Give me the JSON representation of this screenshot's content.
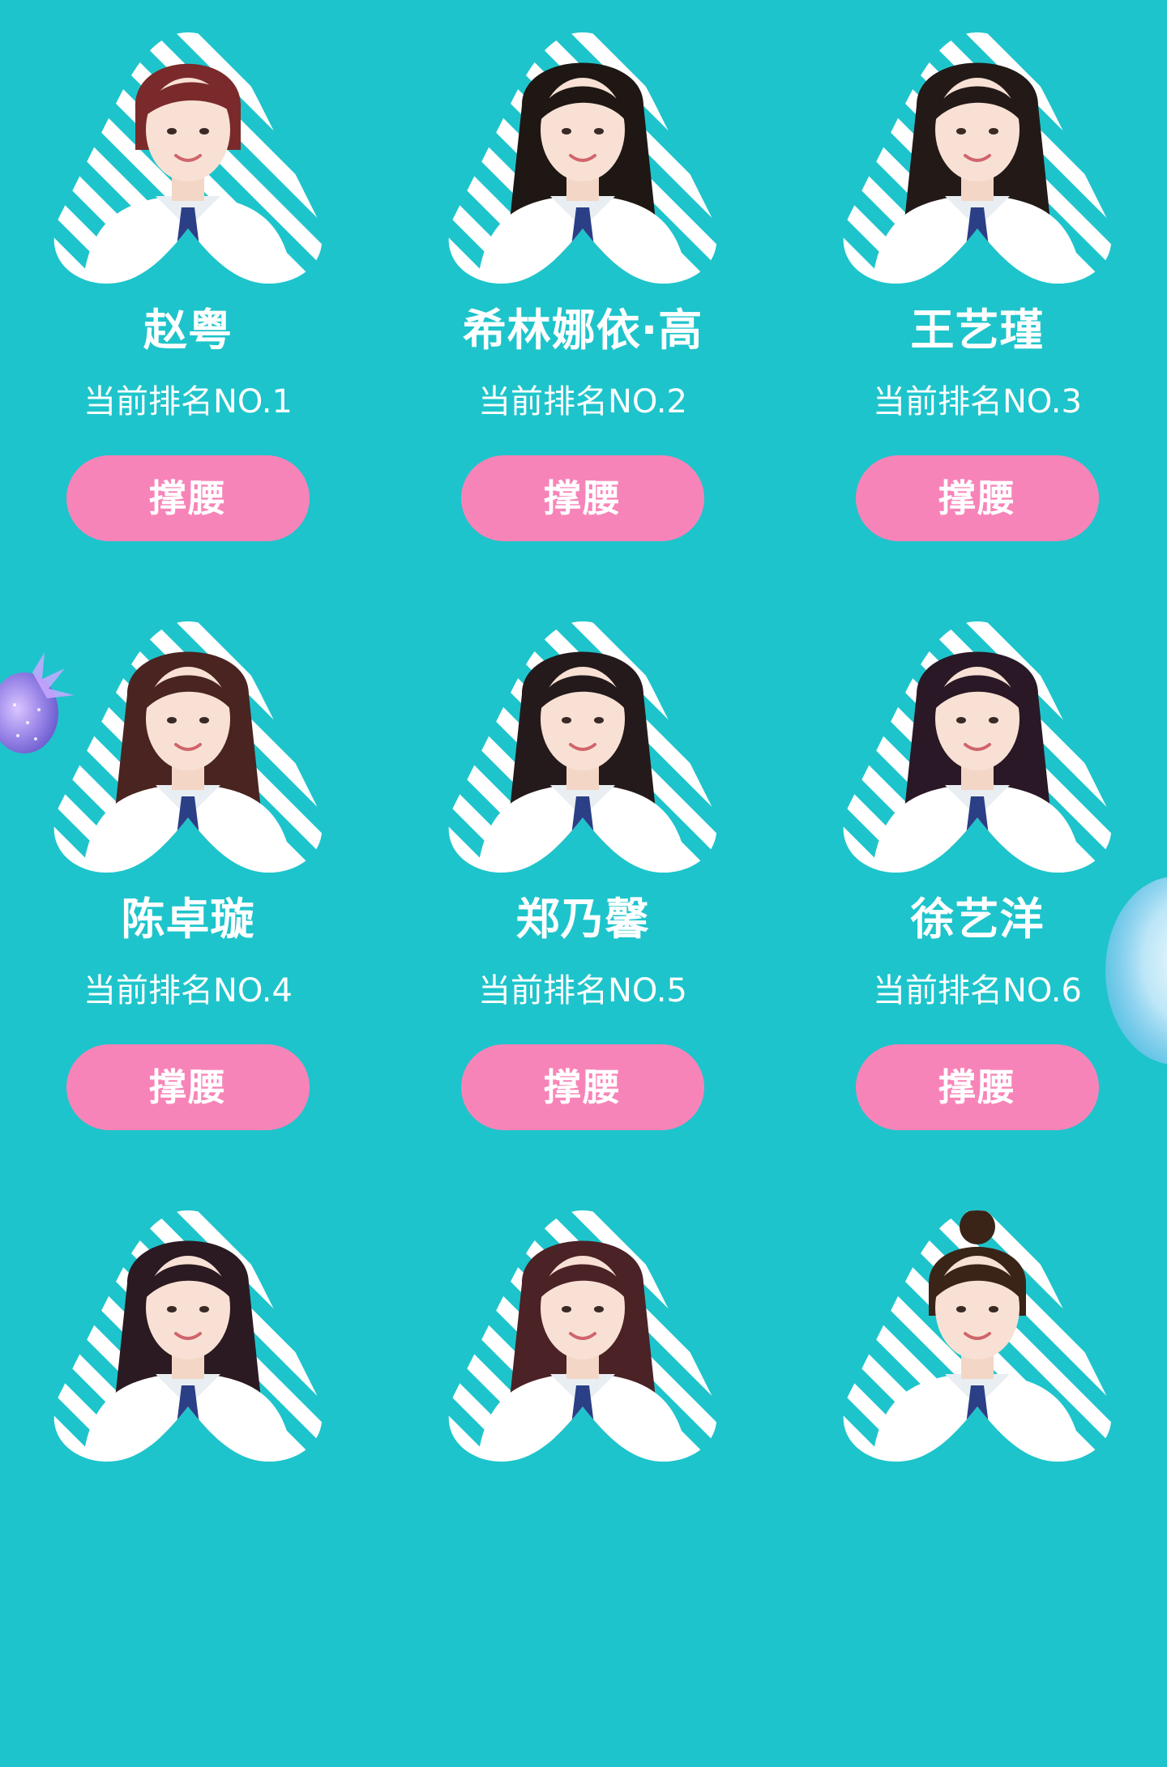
{
  "theme": {
    "background": "#1ec4cb",
    "button_color": "#f784b8",
    "stripe_color": "#1ec4cb",
    "uniform_color": "#ffffff",
    "tie_color": "#2b3f86"
  },
  "contestants": [
    {
      "name": "赵粤",
      "rank_text": "当前排名NO.1",
      "button_label": "撑腰",
      "hair": "#7a2a2a",
      "hair_style": "short"
    },
    {
      "name": "希林娜依·高",
      "rank_text": "当前排名NO.2",
      "button_label": "撑腰",
      "hair": "#1e1713",
      "hair_style": "long"
    },
    {
      "name": "王艺瑾",
      "rank_text": "当前排名NO.3",
      "button_label": "撑腰",
      "hair": "#231a18",
      "hair_style": "long"
    },
    {
      "name": "陈卓璇",
      "rank_text": "当前排名NO.4",
      "button_label": "撑腰",
      "hair": "#4a2420",
      "hair_style": "long"
    },
    {
      "name": "郑乃馨",
      "rank_text": "当前排名NO.5",
      "button_label": "撑腰",
      "hair": "#241a1c",
      "hair_style": "long"
    },
    {
      "name": "徐艺洋",
      "rank_text": "当前排名NO.6",
      "button_label": "撑腰",
      "hair": "#2a1826",
      "hair_style": "long"
    },
    {
      "name": "",
      "rank_text": "",
      "button_label": "",
      "hair": "#2c1a22",
      "hair_style": "long"
    },
    {
      "name": "",
      "rank_text": "",
      "button_label": "",
      "hair": "#4b2226",
      "hair_style": "long"
    },
    {
      "name": "",
      "rank_text": "",
      "button_label": "",
      "hair": "#3a2418",
      "hair_style": "bun"
    }
  ]
}
